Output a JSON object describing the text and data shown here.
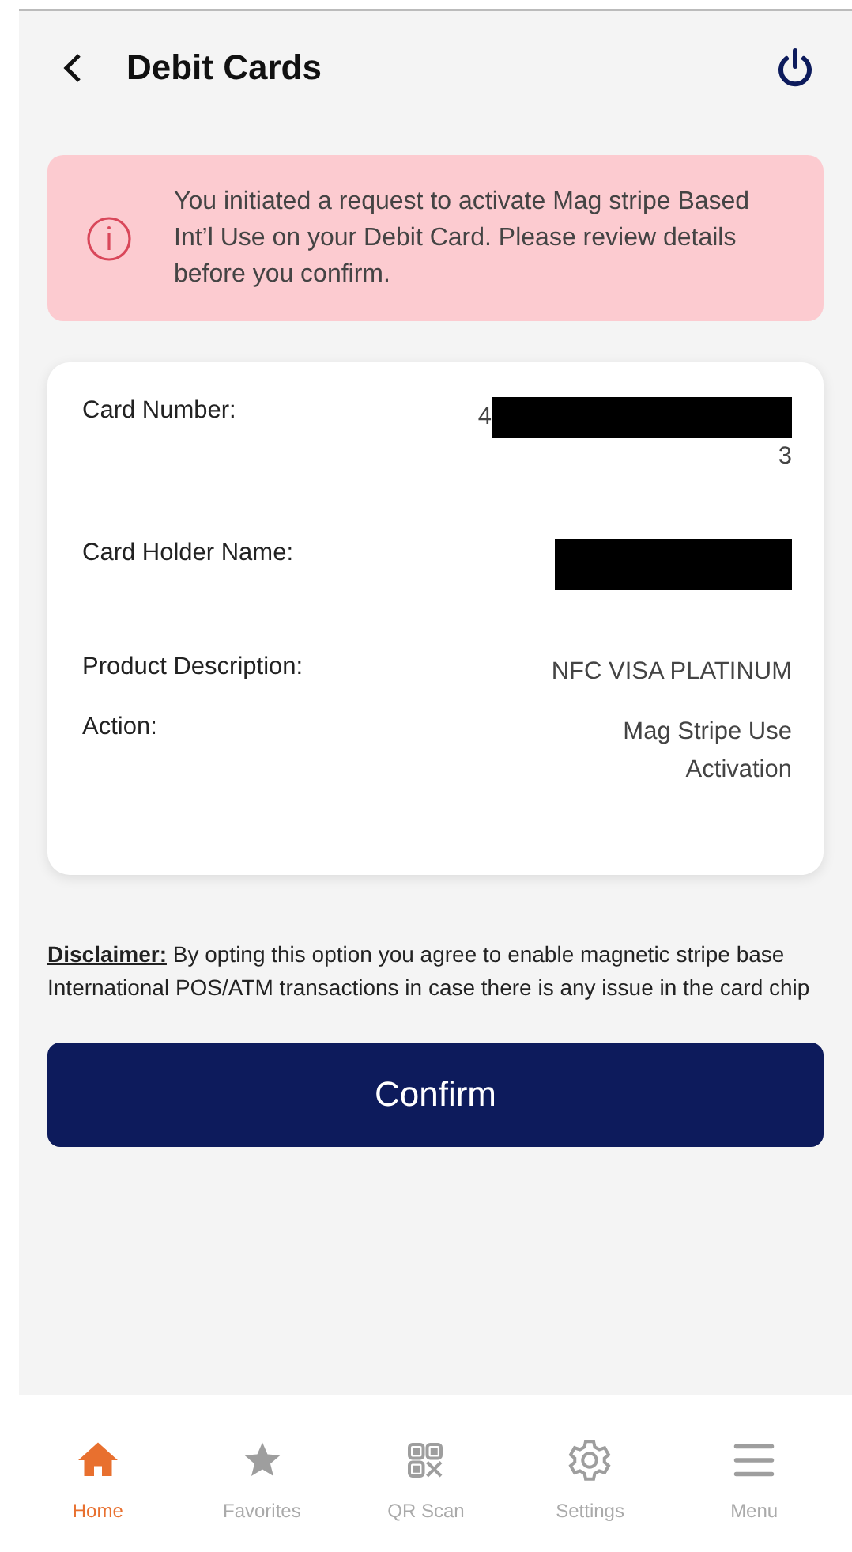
{
  "header": {
    "title": "Debit Cards"
  },
  "alert": {
    "text": "You initiated a request to activate Mag stripe Based Int’l Use on your Debit Card. Please review details before you confirm."
  },
  "details": [
    {
      "label": "Card Number:",
      "value": "4",
      "value_end": "3",
      "redacted": true
    },
    {
      "label": "Card Holder Name:",
      "redacted": true
    },
    {
      "label": "Product Description:",
      "value": "NFC VISA PLATINUM",
      "redacted": false
    },
    {
      "label": "Action:",
      "value": "Mag Stripe Use Activation",
      "redacted": false
    }
  ],
  "disclaimer": {
    "text": "**Disclaimer:** By opting this option you agree to enable magnetic stripe base International POS/ATM transactions in case there is any issue in the card chip"
  },
  "confirm_button": "Confirm",
  "nav": [
    {
      "label": "Home",
      "kind": "home",
      "selected": true
    },
    {
      "label": "Favorites",
      "kind": "star",
      "selected": false
    },
    {
      "label": "QR Scan",
      "kind": "qr",
      "selected": false
    },
    {
      "label": "Settings",
      "kind": "gear",
      "selected": false
    },
    {
      "label": "Menu",
      "kind": "menu",
      "selected": false
    }
  ]
}
